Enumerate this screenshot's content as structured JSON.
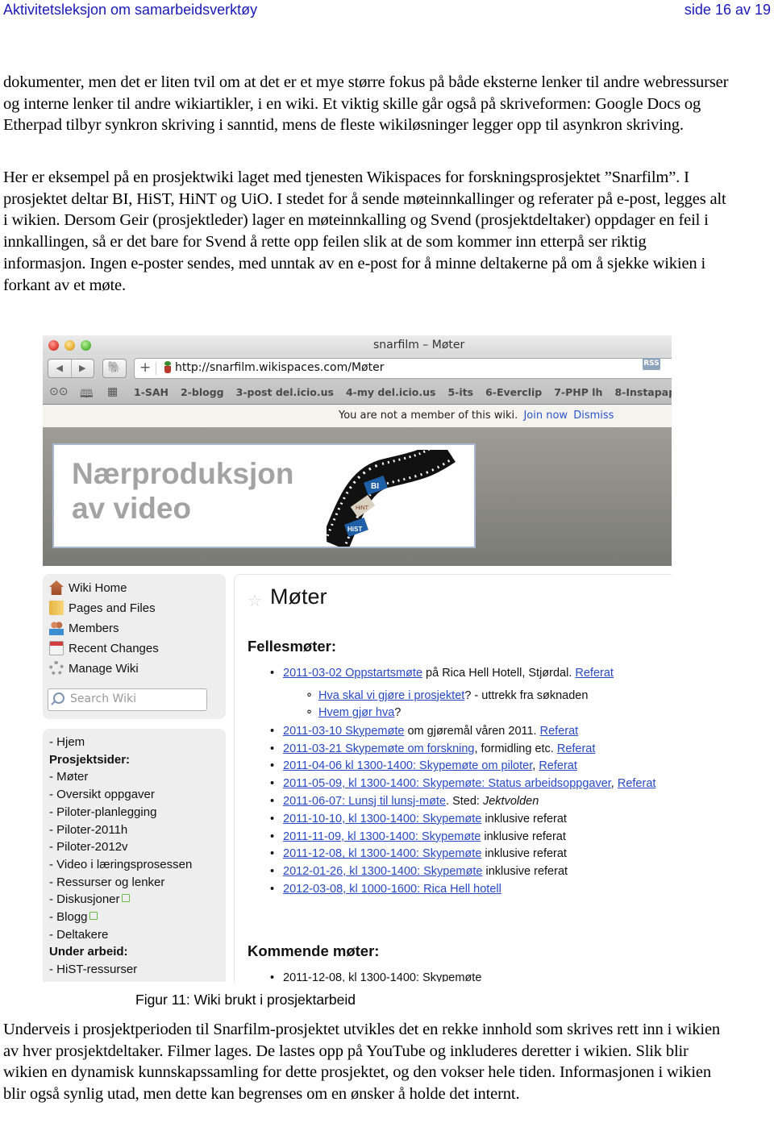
{
  "header": {
    "doc_title": "Aktivitetsleksjon om samarbeidsverktøy",
    "page_indicator": "side 16 av 19"
  },
  "paragraphs": {
    "p1": "dokumenter, men det er liten tvil om at det er et mye større fokus på både eksterne lenker til andre webressurser og interne lenker til andre wikiartikler, i en wiki. Et viktig skille går også på skriveformen: Google Docs og Etherpad tilbyr synkron skriving i sanntid, mens de fleste wikiløsninger legger opp til asynkron skriving.",
    "p2": "Her er eksempel på en prosjektwiki laget med tjenesten Wikispaces for forskningsprosjektet ”Snarfilm”. I prosjektet deltar BI, HiST, HiNT og UiO. I stedet for å sende møteinnkallinger og referater på e-post, legges alt i wikien. Dersom Geir (prosjektleder) lager en møteinnkalling og Svend (prosjektdeltaker) oppdager en feil i innkallingen, så er det bare for Svend å rette opp feilen slik at de som kommer inn etterpå ser riktig informasjon. Ingen e-poster sendes, med unntak av en e-post for å minne deltakerne på om å sjekke wikien i forkant av et møte.",
    "p3": "Underveis i prosjektperioden til Snarfilm-prosjektet utvikles det en rekke innhold som skrives rett inn i wikien av hver prosjektdeltaker. Filmer lages. De lastes opp på YouTube og inkluderes deretter i wikien. Slik blir wikien en dynamisk kunnskapssamling for dette prosjektet, og den vokser hele tiden. Informasjonen i wikien blir også synlig utad, men dette kan begrenses om en ønsker å holde det internt."
  },
  "figure": {
    "caption": "Figur 11: Wiki brukt i prosjektarbeid",
    "browser": {
      "window_title": "snarfilm – Møter",
      "back_icon": "◀",
      "forward_icon": "▶",
      "evernote_icon": "🐘",
      "add_icon": "+",
      "url": "http://snarfilm.wikispaces.com/Møter",
      "rss_label": "RSS",
      "reader_icon": "⊙⊙",
      "bookmarks_book_icon": "📖",
      "topsites_icon": "▦",
      "bookmarks": [
        "1-SAH",
        "2-blogg",
        "3-post del.icio.us",
        "4-my del.icio.us",
        "5-its",
        "6-Everclip",
        "7-PHP lh",
        "8-Instapap"
      ]
    },
    "notice": {
      "text": "You are not a member of this wiki.",
      "join_label": "Join now",
      "dismiss_label": "Dismiss"
    },
    "banner": {
      "line1": "Nærproduksjon",
      "line2": "av video",
      "film_labels": [
        "BI",
        "HiNT",
        "HiST"
      ]
    },
    "wiki_nav": {
      "items": [
        {
          "label": "Wiki Home",
          "icon": "home-icon"
        },
        {
          "label": "Pages and Files",
          "icon": "pages-icon"
        },
        {
          "label": "Members",
          "icon": "members-icon"
        },
        {
          "label": "Recent Changes",
          "icon": "calendar-icon"
        },
        {
          "label": "Manage Wiki",
          "icon": "gear-icon"
        }
      ],
      "search_placeholder": "Search Wiki"
    },
    "project_nav": {
      "lines": [
        {
          "text": "- Hjem",
          "bold": false
        },
        {
          "text": "Prosjektsider:",
          "bold": true
        },
        {
          "text": "- Møter",
          "bold": false
        },
        {
          "text": "- Oversikt oppgaver",
          "bold": false
        },
        {
          "text": "- Piloter-planlegging",
          "bold": false
        },
        {
          "text": "- Piloter-2011h",
          "bold": false
        },
        {
          "text": "- Piloter-2012v",
          "bold": false
        },
        {
          "text": "- Video i læringsprosessen",
          "bold": false
        },
        {
          "text": "- Ressurser og lenker",
          "bold": false
        },
        {
          "text": "- Diskusjoner",
          "bold": false,
          "external": true
        },
        {
          "text": "- Blogg",
          "bold": false,
          "external": true
        },
        {
          "text": "- Deltakere",
          "bold": false
        },
        {
          "text": "Under arbeid:",
          "bold": true
        },
        {
          "text": "- HiST-ressurser",
          "bold": false
        }
      ]
    },
    "content": {
      "star_icon": "☆",
      "page_title": "Møter",
      "fellesmoter_heading": "Fellesmøter:",
      "meetings": [
        {
          "link": "2011-03-02 Oppstartsmøte",
          "text": " på Rica Hell Hotell, Stjørdal. ",
          "ref": "Referat"
        },
        {
          "link": "Hva skal vi gjøre i prosjektet",
          "text": "? - uttrekk fra søknaden",
          "sub": true
        },
        {
          "link": "Hvem gjør hva",
          "text": "?",
          "sub": true
        },
        {
          "link": "2011-03-10 Skypemøte",
          "text": " om gjøremål våren 2011. ",
          "ref": "Referat"
        },
        {
          "link": "2011-03-21 Skypemøte om forskning",
          "text": ", formidling etc. ",
          "ref": "Referat"
        },
        {
          "link": "2011-04-06 kl 1300-1400: Skypemøte om piloter",
          "text": ", ",
          "ref": "Referat"
        },
        {
          "link": "2011-05-09, kl 1300-1400: Skypemøte: Status arbeidsoppgaver",
          "text": ", ",
          "ref": "Referat"
        },
        {
          "link": "2011-06-07: Lunsj til lunsj-møte",
          "text": ". Sted: ",
          "italic": "Jektvolden"
        },
        {
          "link": "2011-10-10, kl 1300-1400: Skypemøte",
          "text": " inklusive referat"
        },
        {
          "link": "2011-11-09, kl 1300-1400: Skypemøte",
          "text": " inklusive referat"
        },
        {
          "link": "2011-12-08, kl 1300-1400: Skypemøte",
          "text": " inklusive referat"
        },
        {
          "link": "2012-01-26, kl 1300-1400: Skypemøte",
          "text": " inklusive referat"
        },
        {
          "link": "2012-03-08, kl 1000-1600: Rica Hell hotell",
          "text": ""
        }
      ],
      "kommende_heading": "Kommende møter:",
      "upcoming": [
        "2011-12-08, kl 1300-1400: Skypemøte"
      ]
    }
  },
  "colors": {
    "header_text": "#1a1ab8",
    "link": "#2749c4",
    "banner_text": "#a3a3a3",
    "sidebar_bg": "#eeeeee"
  }
}
